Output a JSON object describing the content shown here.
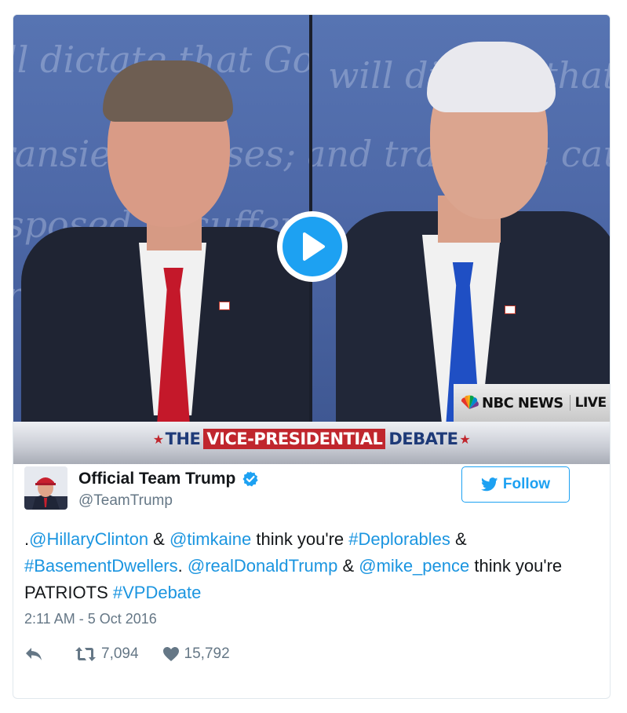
{
  "video": {
    "broadcast_label": "NBC NEWS",
    "live_label": "LIVE",
    "banner_the": "THE",
    "banner_vp": "VICE-PRESIDENTIAL",
    "banner_debate": "DEBATE",
    "star": "★"
  },
  "tweet": {
    "display_name": "Official Team Trump",
    "handle": "@TeamTrump",
    "follow_label": "Follow",
    "text_parts": {
      "p1": ".",
      "m1": "@HillaryClinton",
      "p2": " & ",
      "m2": "@timkaine",
      "p3": " think you're ",
      "h1": "#Deplorables",
      "p4": " & ",
      "h2": "#BasementDwellers",
      "p5": ". ",
      "m3": "@realDonaldTrump",
      "p6": " & ",
      "m4": "@mike_pence",
      "p7": " think you're PATRIOTS ",
      "h3": "#VPDebate"
    },
    "timestamp": "2:11 AM - 5 Oct 2016",
    "retweet_count": "7,094",
    "like_count": "15,792"
  },
  "colors": {
    "accent": "#1da1f2",
    "link": "#1b95e0",
    "text": "#14171a",
    "muted": "#657786",
    "banner_red": "#c0262d",
    "banner_blue": "#1e3a78"
  },
  "icons": {
    "play": "play-icon",
    "verified": "verified-badge-icon",
    "bird": "twitter-bird-icon",
    "reply": "reply-icon",
    "retweet": "retweet-icon",
    "like": "heart-icon"
  }
}
